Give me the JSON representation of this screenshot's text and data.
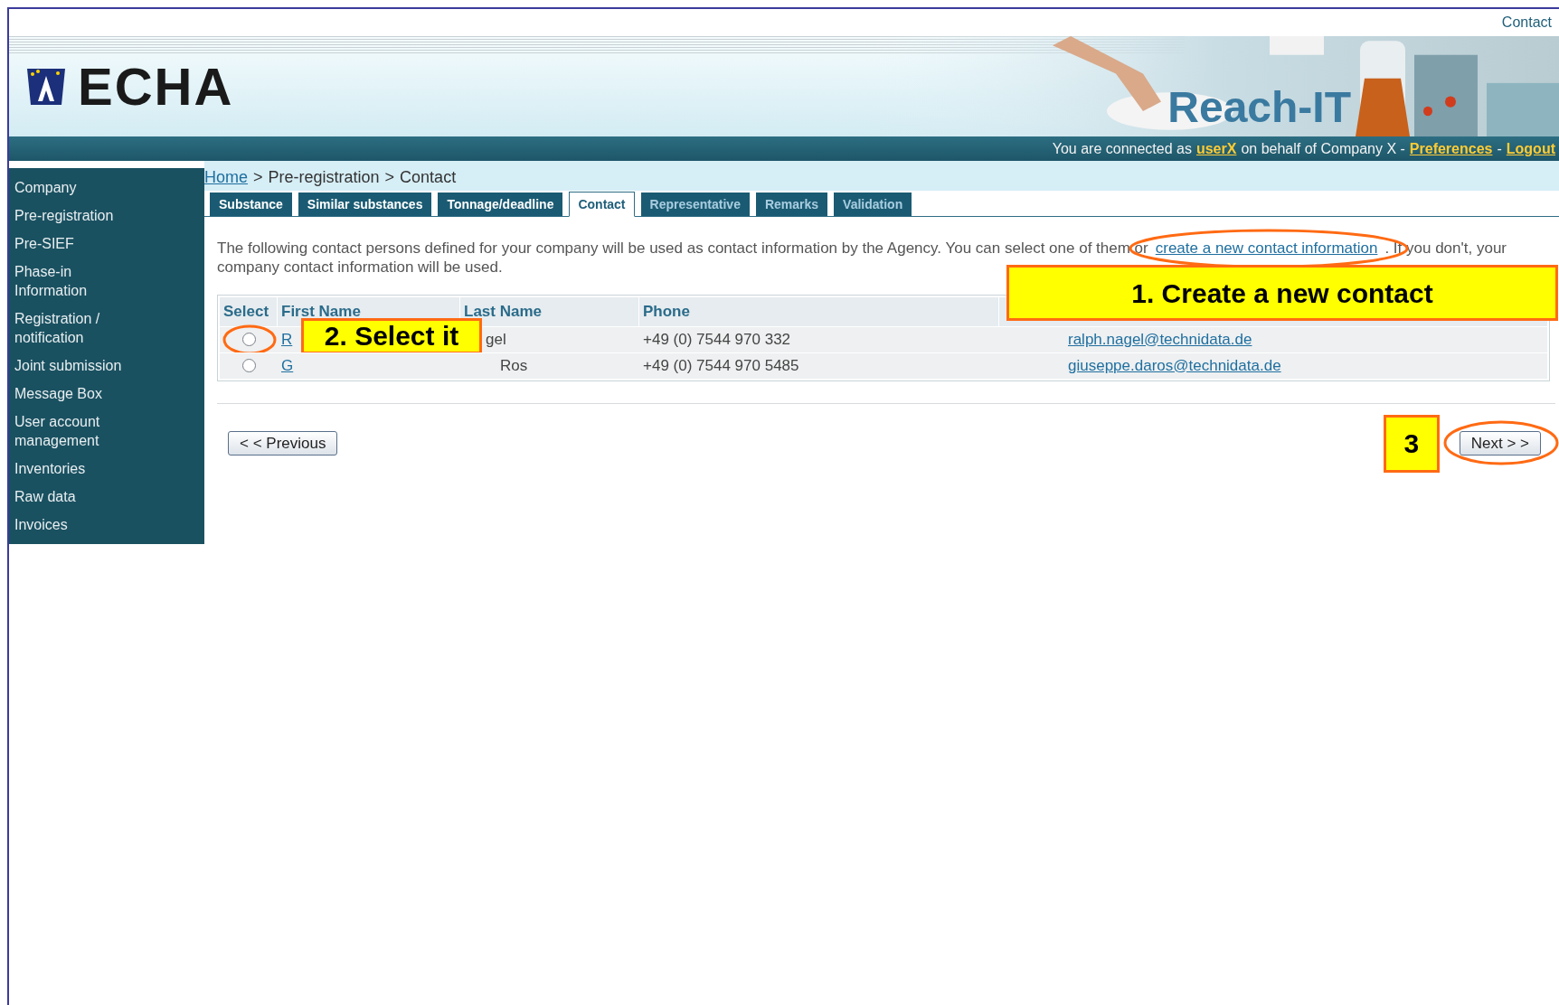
{
  "header": {
    "contact_link": "Contact",
    "logo_text": "ECHA",
    "product_name": "Reach-IT",
    "status": {
      "prefix": "You are connected as",
      "user": "userX",
      "middle": "on behalf of Company X -",
      "preferences": "Preferences",
      "separator": "-",
      "logout": "Logout"
    }
  },
  "sidebar": {
    "items": [
      {
        "label": "Company"
      },
      {
        "label": "Pre-registration"
      },
      {
        "label": "Pre-SIEF"
      },
      {
        "label": "Phase-in Information"
      },
      {
        "label": "Registration / notification"
      },
      {
        "label": "Joint submission"
      },
      {
        "label": "Message Box"
      },
      {
        "label": "User account management"
      },
      {
        "label": "Inventories"
      },
      {
        "label": "Raw data"
      },
      {
        "label": "Invoices"
      }
    ]
  },
  "breadcrumb": {
    "separator": ">",
    "items": [
      {
        "label": "Home",
        "link": true
      },
      {
        "label": "Pre-registration",
        "link": false
      },
      {
        "label": "Contact",
        "link": false
      }
    ]
  },
  "tabs": [
    {
      "label": "Substance",
      "selected": false
    },
    {
      "label": "Similar substances",
      "selected": false
    },
    {
      "label": "Tonnage/deadline",
      "selected": false
    },
    {
      "label": "Contact",
      "selected": true
    },
    {
      "label": "Representative",
      "selected": false
    },
    {
      "label": "Remarks",
      "selected": false
    },
    {
      "label": "Validation",
      "selected": false
    }
  ],
  "intro": {
    "before": "The following contact persons defined for your company will be used as contact information by the Agency. You can select one of them or",
    "link": "create a new contact information",
    "after": ". If you don't, your company contact information will be used."
  },
  "table": {
    "columns": [
      "Select",
      "First Name",
      "Last Name",
      "Phone"
    ],
    "rows": [
      {
        "selected": false,
        "first_name": "R",
        "last_name": "gel",
        "phone": "+49 (0) 7544 970 332",
        "email": "ralph.nagel@technidata.de"
      },
      {
        "selected": false,
        "first_name": "G",
        "last_name": "Ros",
        "phone": "+49 (0) 7544 970 5485",
        "email": "giuseppe.daros@technidata.de"
      }
    ]
  },
  "buttons": {
    "previous": "< < Previous",
    "next": "Next > >"
  },
  "annotations": [
    {
      "text": "1. Create a new contact"
    },
    {
      "text": "2. Select it"
    },
    {
      "text": "3"
    }
  ]
}
